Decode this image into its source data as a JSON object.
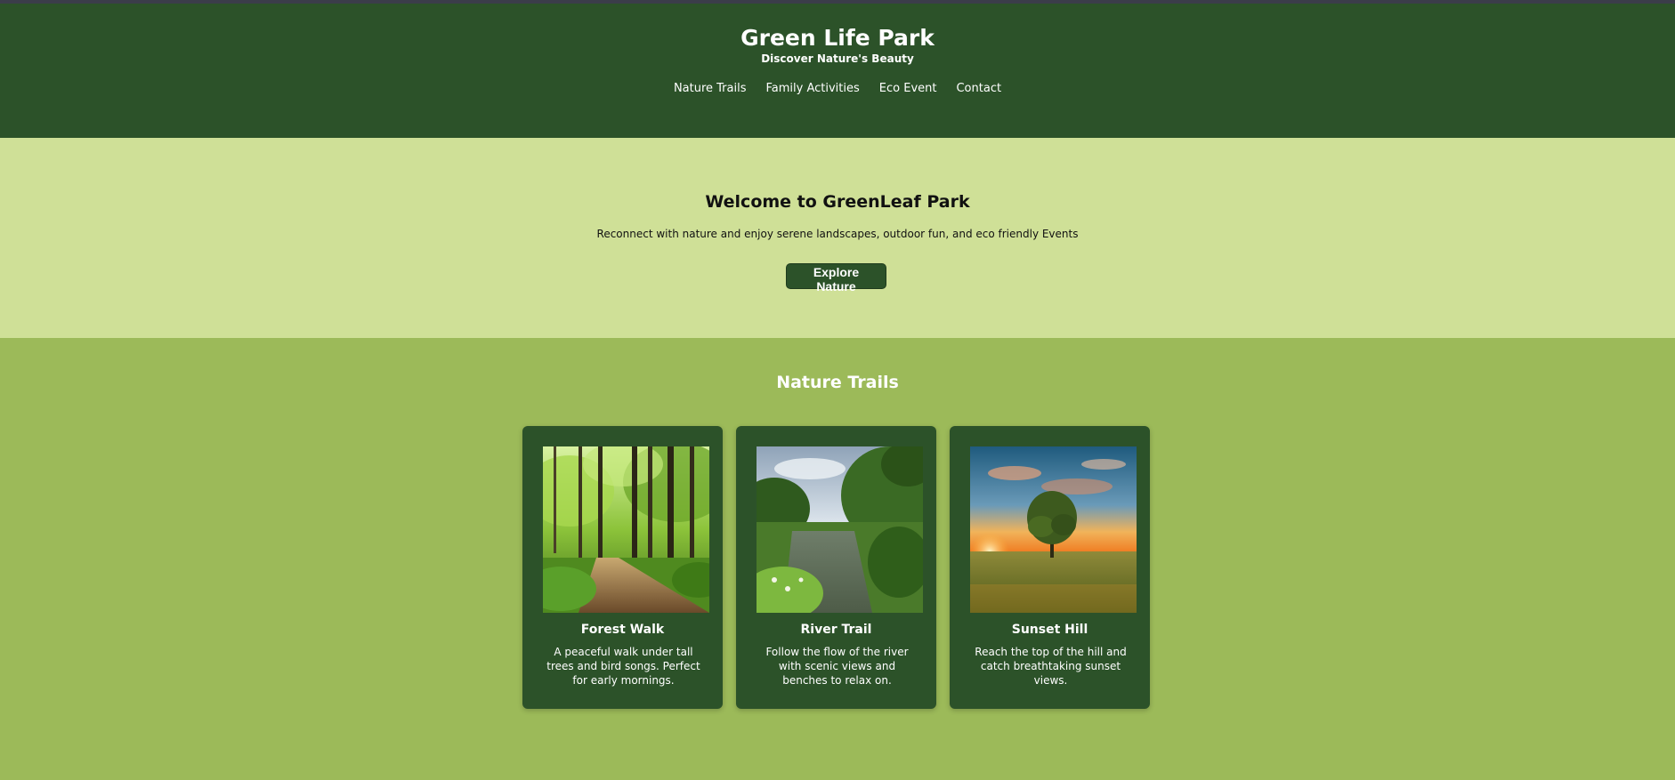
{
  "header": {
    "title": "Green Life Park",
    "subtitle": "Discover Nature's Beauty",
    "nav": [
      "Nature Trails",
      "Family Activities",
      "Eco Event",
      "Contact"
    ]
  },
  "hero": {
    "title": "Welcome to GreenLeaf Park",
    "text": "Reconnect with nature and enjoy serene landscapes, outdoor fun, and eco friendly Events",
    "button": "Explore Nature"
  },
  "trails": {
    "title": "Nature Trails",
    "cards": [
      {
        "title": "Forest Walk",
        "text": "A peaceful walk under tall trees and bird songs. Perfect for early mornings.",
        "image_icon": "forest-path-photo"
      },
      {
        "title": "River Trail",
        "text": "Follow the flow of the river with scenic views and benches to relax on.",
        "image_icon": "river-photo"
      },
      {
        "title": "Sunset Hill",
        "text": "Reach the top of the hill and catch breathtaking sunset views.",
        "image_icon": "sunset-tree-photo"
      }
    ]
  },
  "colors": {
    "header_bg": "#2c5229",
    "hero_bg": "#cfe097",
    "trails_bg": "#9cba59",
    "card_bg": "#2c5229"
  }
}
